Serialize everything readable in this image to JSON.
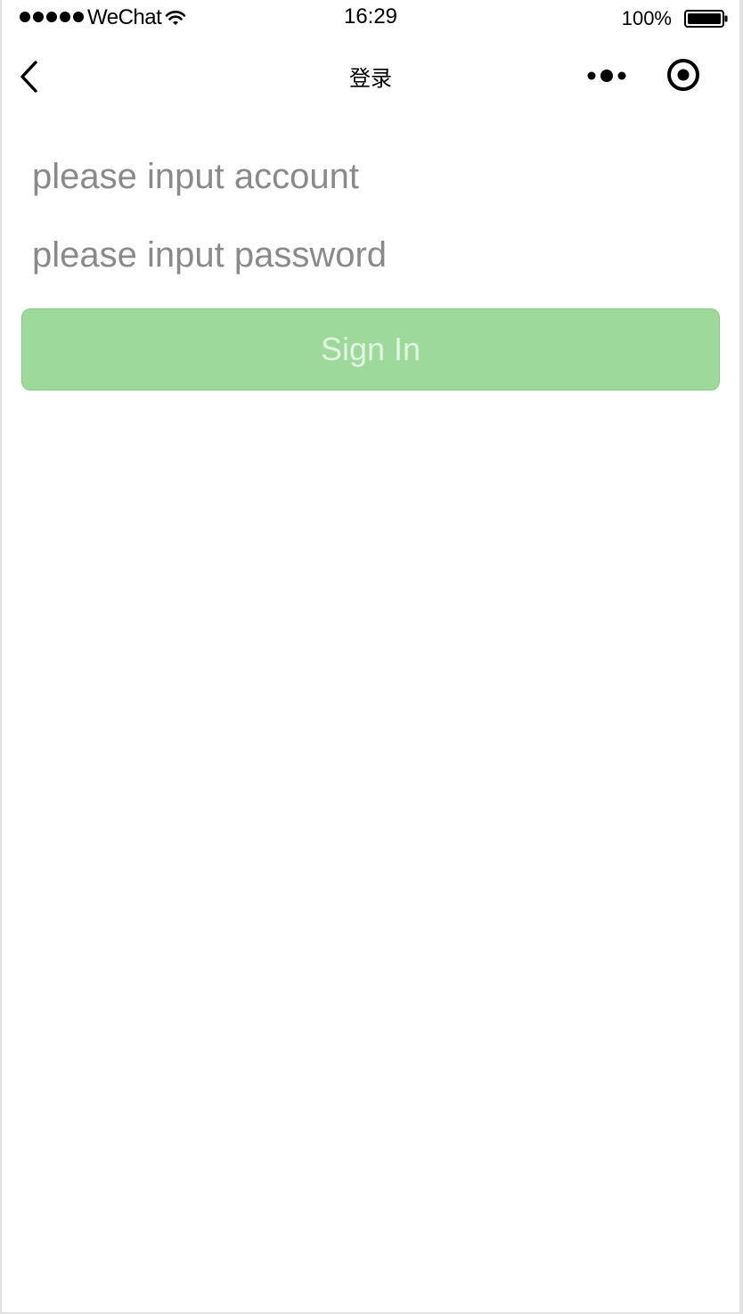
{
  "status_bar": {
    "carrier": "WeChat",
    "time": "16:29",
    "battery_percent": "100%"
  },
  "nav_bar": {
    "title": "登录"
  },
  "form": {
    "account_placeholder": "please input account",
    "password_placeholder": "please input password",
    "sign_in_label": "Sign In"
  },
  "colors": {
    "button_bg": "#9ed99c",
    "button_text": "#e3f3e2",
    "placeholder": "#8a8a8a"
  },
  "icons": {
    "signal": "signal-dots-icon",
    "wifi": "wifi-icon",
    "battery": "battery-icon",
    "back": "chevron-left-icon",
    "more": "more-dots-icon",
    "close": "target-circle-icon"
  }
}
